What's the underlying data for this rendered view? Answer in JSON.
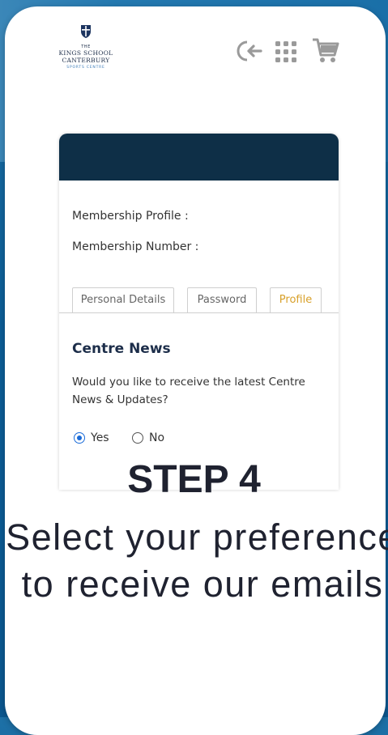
{
  "logo": {
    "line1": "THE",
    "line2a": "KINGS SCHOOL",
    "line2b": "CANTERBURY",
    "line3": "SPORTS CENTRE"
  },
  "header_icons": [
    "back-arrow-icon",
    "grid-menu-icon",
    "cart-icon"
  ],
  "profile": {
    "membership_profile_label": "Membership Profile :",
    "membership_number_label": "Membership Number :"
  },
  "tabs": [
    {
      "label": "Personal Details",
      "active": false
    },
    {
      "label": "Password",
      "active": false
    },
    {
      "label": "Profile",
      "active": true
    }
  ],
  "centre_news": {
    "title": "Centre News",
    "question": "Would you like to receive the latest Centre News & Updates?",
    "options": [
      {
        "label": "Yes",
        "checked": true
      },
      {
        "label": "No",
        "checked": false
      }
    ]
  },
  "instruction": {
    "step": "STEP 4",
    "text": "Select your preference to receive our emails"
  },
  "colors": {
    "card_header": "#0e2f47",
    "active_tab": "#d8a02a",
    "radio_selected": "#1a6bd8",
    "background": "#0c5d96"
  }
}
